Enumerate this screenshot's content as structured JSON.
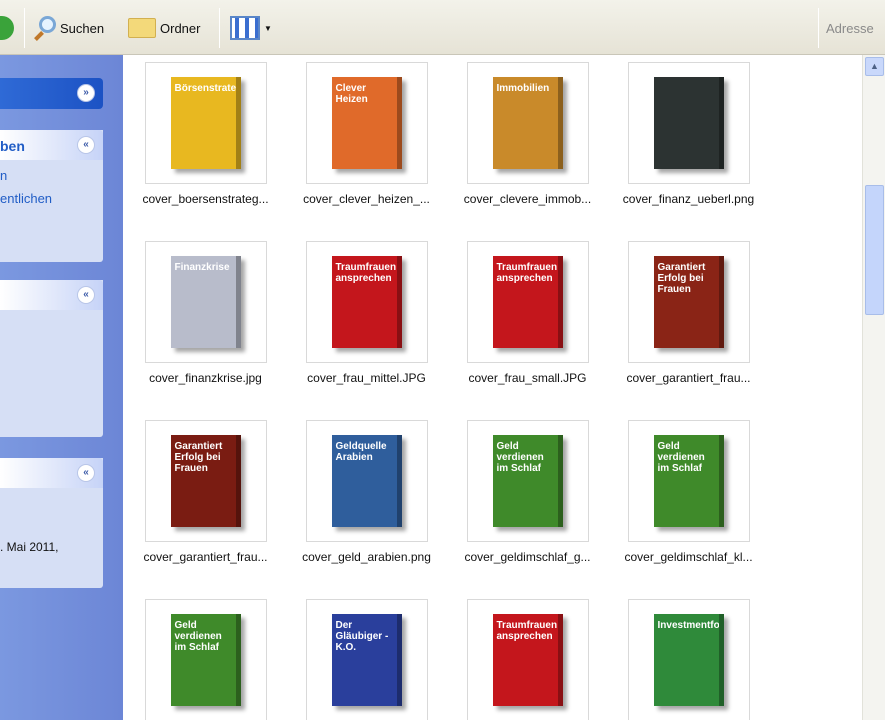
{
  "toolbar": {
    "search_label": "Suchen",
    "folders_label": "Ordner",
    "address_label": "Adresse"
  },
  "sidebar": {
    "panels": [
      {
        "title": "",
        "expanded": false
      },
      {
        "title": "ben",
        "links": [
          "n",
          "entlichen"
        ]
      },
      {
        "title": ""
      },
      {
        "title": "",
        "detail": ". Mai 2011,"
      }
    ]
  },
  "files": [
    {
      "name": "cover_boersenstrateg...",
      "cover": "Börsenstrategien",
      "color": "#e8b820"
    },
    {
      "name": "cover_clever_heizen_...",
      "cover": "Clever Heizen",
      "color": "#e06a2a"
    },
    {
      "name": "cover_clevere_immob...",
      "cover": "Immobilien",
      "color": "#c98a2a"
    },
    {
      "name": "cover_finanz_ueberl.png",
      "cover": "",
      "color": "#2c3332"
    },
    {
      "name": "cover_finanzkrise.jpg",
      "cover": "Finanzkrise",
      "color": "#b8bccb"
    },
    {
      "name": "cover_frau_mittel.JPG",
      "cover": "Traumfrauen ansprechen",
      "color": "#c4161c"
    },
    {
      "name": "cover_frau_small.JPG",
      "cover": "Traumfrauen ansprechen",
      "color": "#c4161c"
    },
    {
      "name": "cover_garantiert_frau...",
      "cover": "Garantiert Erfolg bei Frauen",
      "color": "#8a2416"
    },
    {
      "name": "cover_garantiert_frau...",
      "cover": "Garantiert Erfolg bei Frauen",
      "color": "#7a1c12"
    },
    {
      "name": "cover_geld_arabien.png",
      "cover": "Geldquelle Arabien",
      "color": "#2f5e9c"
    },
    {
      "name": "cover_geldimschlaf_g...",
      "cover": "Geld verdienen im Schlaf",
      "color": "#3f8a2a"
    },
    {
      "name": "cover_geldimschlaf_kl...",
      "cover": "Geld verdienen im Schlaf",
      "color": "#3f8a2a"
    },
    {
      "name": "",
      "cover": "Geld verdienen im Schlaf",
      "color": "#3f8a2a"
    },
    {
      "name": "",
      "cover": "Der Gläubiger - K.O.",
      "color": "#2a3f9c"
    },
    {
      "name": "",
      "cover": "Traumfrauen ansprechen",
      "color": "#c4161c"
    },
    {
      "name": "",
      "cover": "Investmentfonds",
      "color": "#2f8a3a"
    }
  ]
}
